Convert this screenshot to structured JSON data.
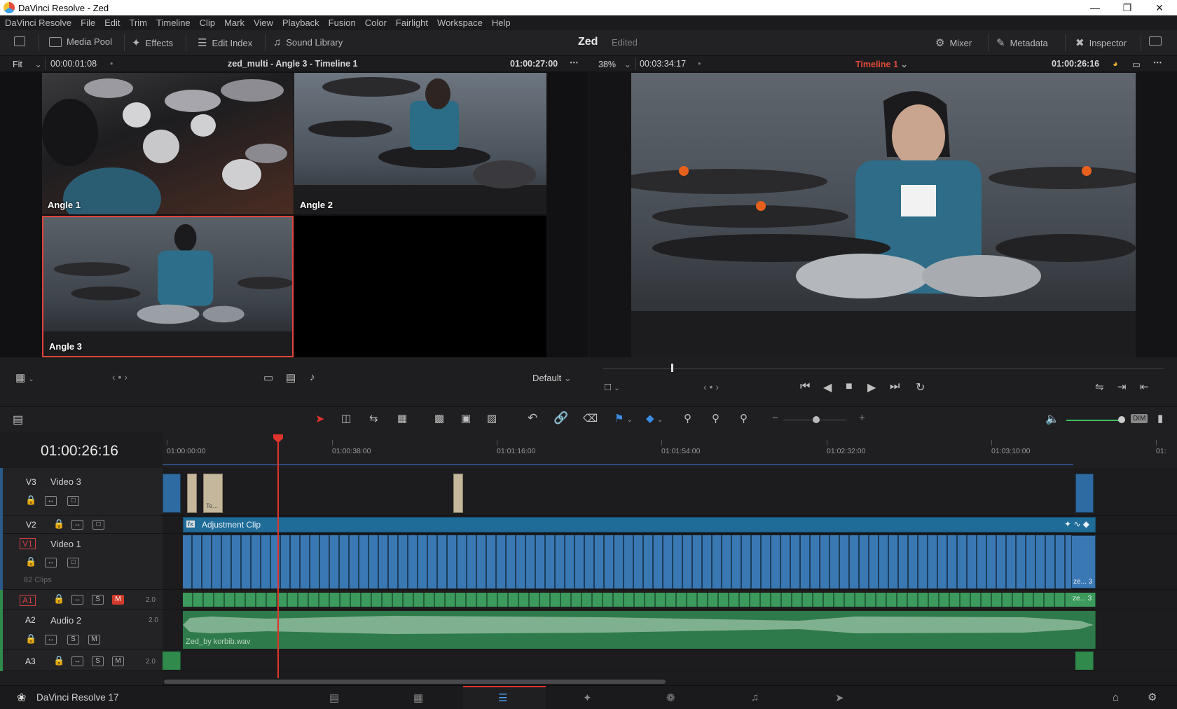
{
  "window": {
    "title": "DaVinci Resolve - Zed"
  },
  "menu": [
    "DaVinci Resolve",
    "File",
    "Edit",
    "Trim",
    "Timeline",
    "Clip",
    "Mark",
    "View",
    "Playback",
    "Fusion",
    "Color",
    "Fairlight",
    "Workspace",
    "Help"
  ],
  "toolbar": {
    "media_pool": "Media Pool",
    "effects": "Effects",
    "edit_index": "Edit Index",
    "sound_library": "Sound Library",
    "project_name": "Zed",
    "project_status": "Edited",
    "mixer": "Mixer",
    "metadata": "Metadata",
    "inspector": "Inspector"
  },
  "source_viewer": {
    "zoom": "Fit",
    "timecode": "00:00:01:08",
    "title": "zed_multi - Angle 3 - Timeline 1",
    "end_timecode": "01:00:27:00",
    "angles": [
      "Angle 1",
      "Angle 2",
      "Angle 3"
    ],
    "layout_preset": "Default"
  },
  "program_viewer": {
    "zoom": "38%",
    "duration": "00:03:34:17",
    "timeline_name": "Timeline 1",
    "timecode": "01:00:26:16"
  },
  "timeline": {
    "current_timecode": "01:00:26:16",
    "ruler_labels": [
      "01:00:00:00",
      "01:00:38:00",
      "01:01:16:00",
      "01:01:54:00",
      "01:02:32:00",
      "01:03:10:00",
      "01:"
    ],
    "tracks": {
      "v3": {
        "id": "V3",
        "name": "Video 3"
      },
      "v2": {
        "id": "V2",
        "clip": "Adjustment Clip"
      },
      "v1": {
        "id": "V1",
        "name": "Video 1",
        "clip_count": "82 Clips",
        "end_clip": "ze... 3"
      },
      "a1": {
        "id": "A1",
        "channels": "2.0",
        "end_clip": "ze... 3"
      },
      "a2": {
        "id": "A2",
        "name": "Audio 2",
        "channels": "2.0",
        "clip": "Zed_by korbib.wav"
      },
      "a3": {
        "id": "A3",
        "channels": "2.0"
      }
    },
    "v3_small_clip_label": "Te...",
    "dim_label": "DIM"
  },
  "pagebar": {
    "app_name": "DaVinci Resolve 17"
  },
  "colors": {
    "accent_red": "#e0342c",
    "video_clip": "#3a78b4",
    "audio_clip": "#3c9a5c",
    "adjustment": "#2272a0"
  }
}
